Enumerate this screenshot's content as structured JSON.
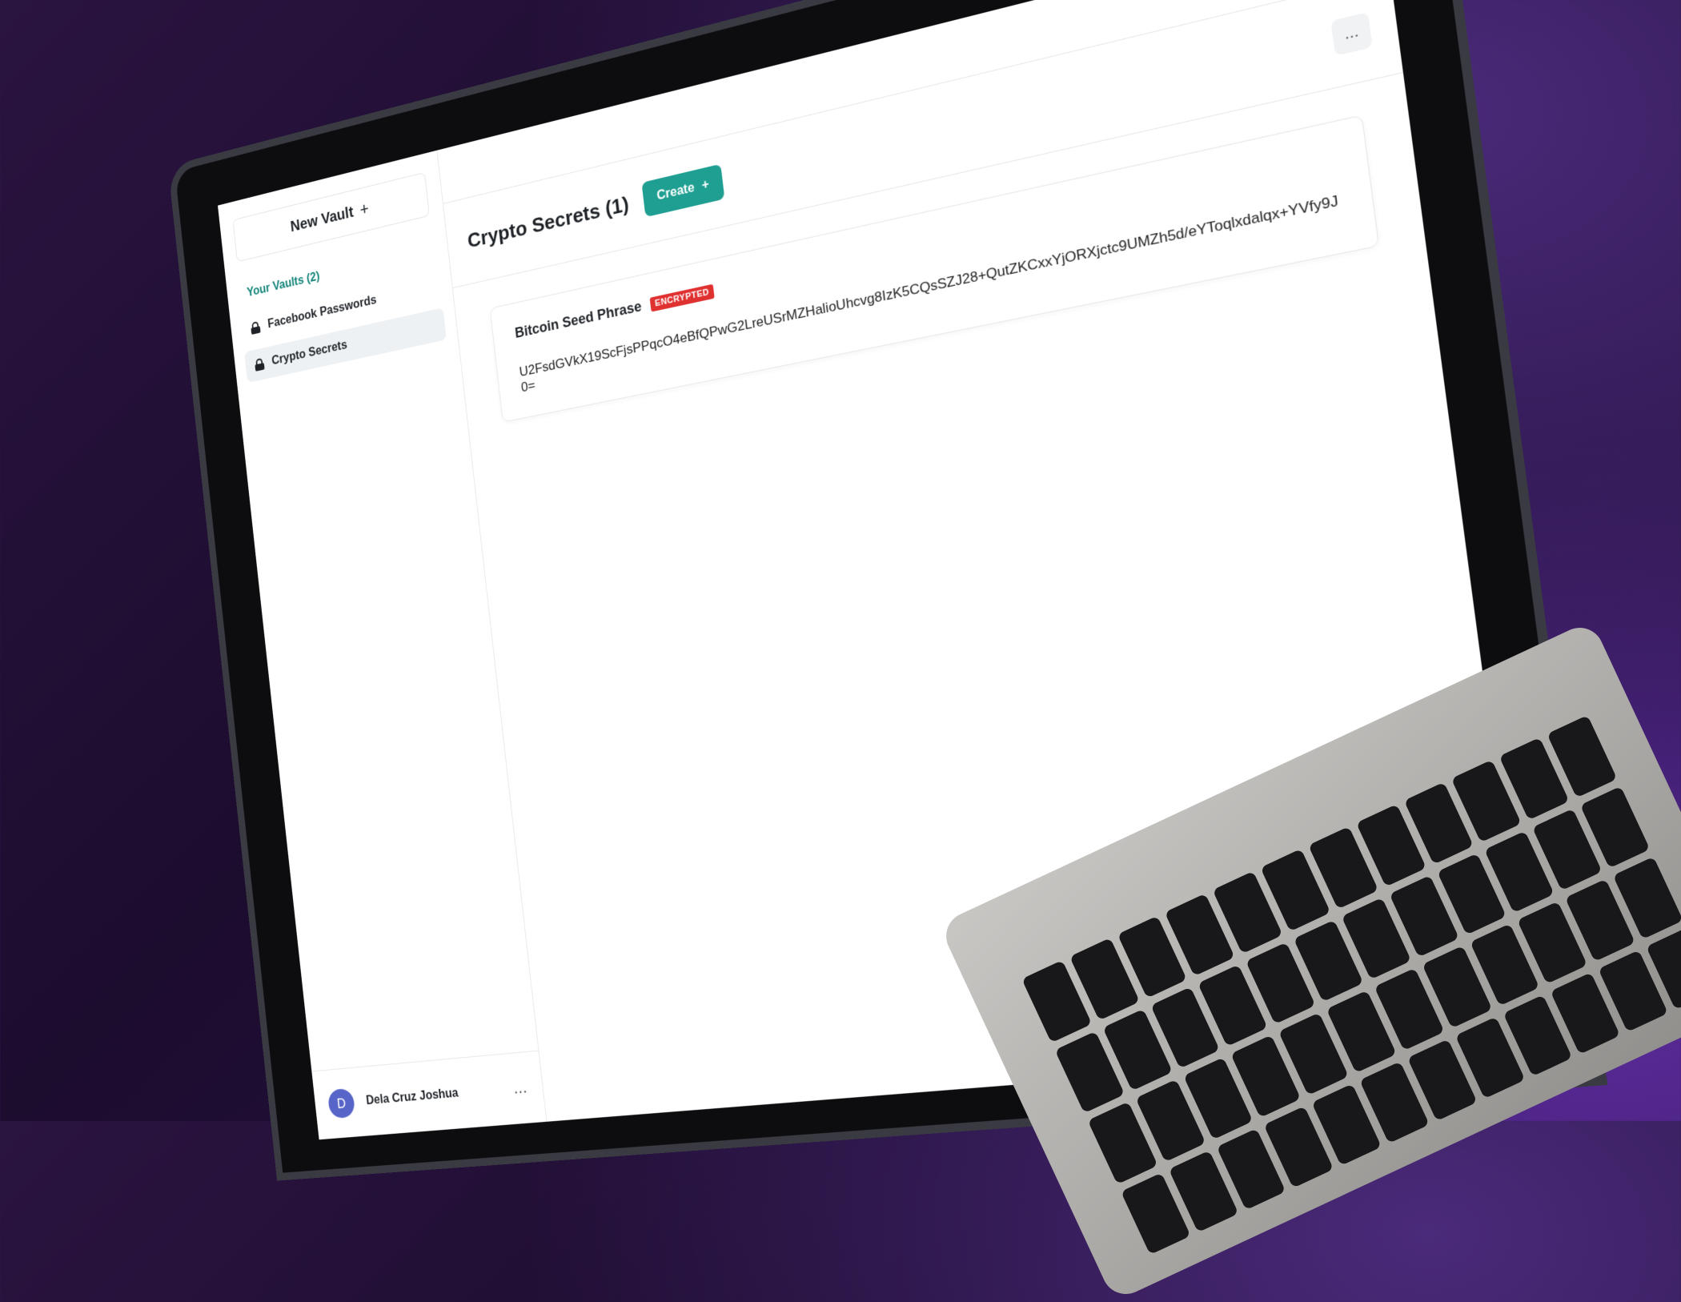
{
  "sidebar": {
    "new_vault_label": "New Vault",
    "new_vault_plus": "+",
    "vaults_heading": "Your Vaults (2)",
    "vaults": [
      {
        "label": "Facebook Passwords"
      },
      {
        "label": "Crypto Secrets"
      }
    ],
    "user": {
      "avatar_initial": "D",
      "name": "Dela Cruz Joshua",
      "menu": "…"
    }
  },
  "topbar": {
    "settings_icon": "⚙"
  },
  "main": {
    "title": "Crypto Secrets (1)",
    "create_label": "Create",
    "create_plus": "+",
    "more_menu": "…",
    "secrets": [
      {
        "title": "Bitcoin Seed Phrase",
        "badge": "ENCRYPTED",
        "value": "U2FsdGVkX19ScFjsPPqcO4eBfQPwG2LreUSrMZHalioUhcvg8IzK5CQsSZJ28+QutZKCxxYjORXjctc9UMZh5d/eYToqlxdalqx+YVfy9J0="
      }
    ]
  },
  "colors": {
    "accent": "#1e9f91",
    "badge": "#e03131",
    "avatar": "#5865c8"
  }
}
